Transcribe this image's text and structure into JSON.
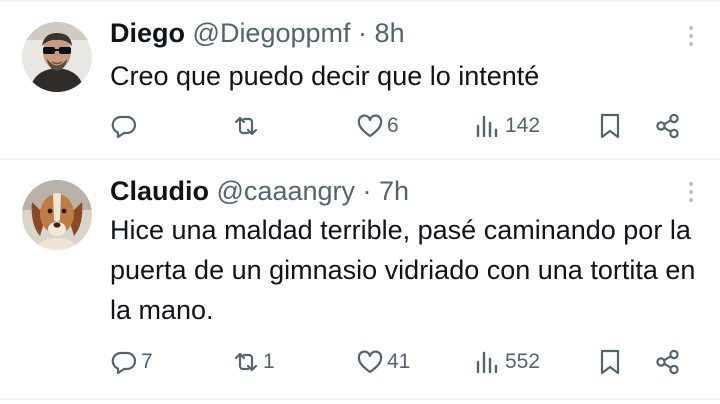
{
  "tweets": [
    {
      "name": "Diego",
      "handle": "@Diegoppmf",
      "separator": "·",
      "time": "8h",
      "text": "Creo que puedo decir que lo intenté",
      "replies": "",
      "retweets": "",
      "likes": "6",
      "views": "142",
      "avatar_icon": "avatar-man-sunglasses"
    },
    {
      "name": "Claudio",
      "handle": "@caaangry",
      "separator": "·",
      "time": "7h",
      "text": "Hice una maldad terrible, pasé caminando por la puerta de un gimnasio vidriado con una tortita en la mano.",
      "replies": "7",
      "retweets": "1",
      "likes": "41",
      "views": "552",
      "avatar_icon": "avatar-dog"
    }
  ],
  "colors": {
    "text": "#0f1419",
    "secondary": "#536471",
    "divider": "#eff3f4"
  },
  "icons": [
    "more-icon",
    "reply-icon",
    "retweet-icon",
    "like-icon",
    "views-icon",
    "bookmark-icon",
    "share-icon"
  ]
}
